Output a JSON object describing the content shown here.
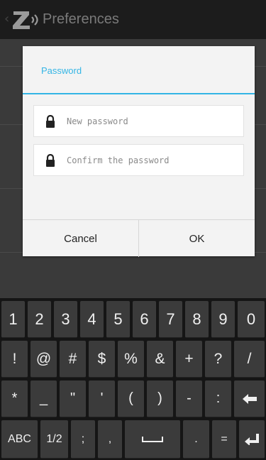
{
  "app": {
    "title": "Preferences",
    "back_glyph": "‹",
    "logo_icon": "z-logo-icon"
  },
  "dialog": {
    "title": "Password",
    "fields": [
      {
        "placeholder": "New password",
        "value": "",
        "icon": "lock-icon"
      },
      {
        "placeholder": "Confirm the password",
        "value": "",
        "icon": "lock-icon"
      }
    ],
    "cancel_label": "Cancel",
    "ok_label": "OK",
    "accent_color": "#33b5e5"
  },
  "keyboard": {
    "row1": [
      "1",
      "2",
      "3",
      "4",
      "5",
      "6",
      "7",
      "8",
      "9",
      "0"
    ],
    "row2": [
      "!",
      "@",
      "#",
      "$",
      "%",
      "&",
      "+",
      "?",
      "/"
    ],
    "row3": [
      "*",
      "_",
      "\"",
      "'",
      "(",
      ")",
      "-",
      ":",
      "backspace-icon"
    ],
    "row4": [
      "ABC",
      "1/2",
      ";",
      ",",
      "space-icon",
      ".",
      "=",
      "enter-icon"
    ]
  }
}
